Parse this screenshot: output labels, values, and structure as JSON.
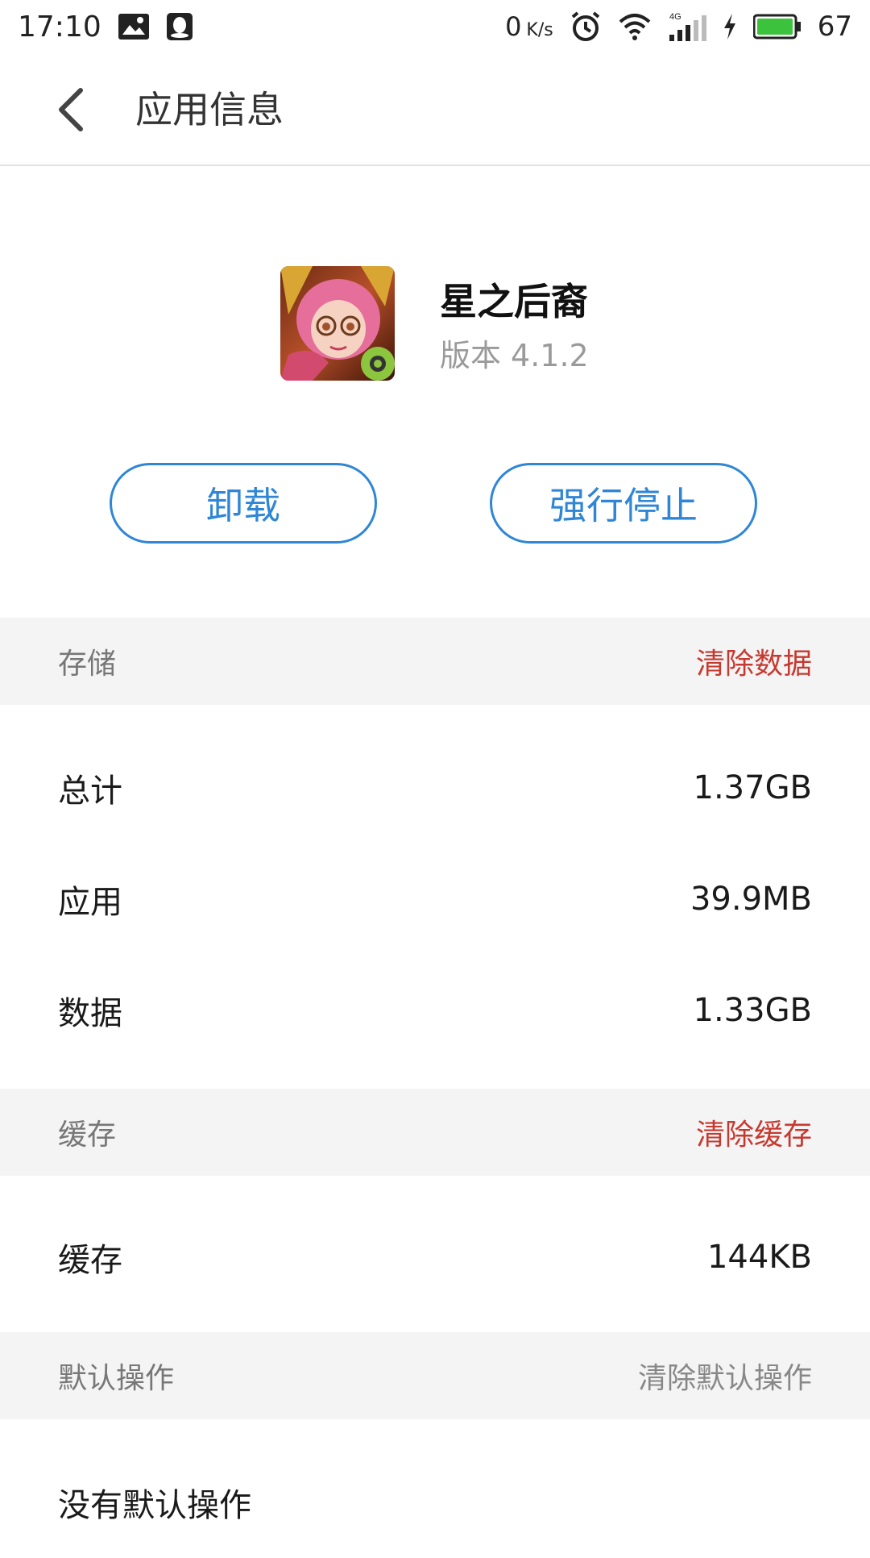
{
  "status_bar": {
    "time": "17:10",
    "net_speed_value": "0",
    "net_speed_unit": "K/s",
    "network_type": "4G",
    "battery_level": "67",
    "battery_color": "#3cc23c"
  },
  "title_bar": {
    "title": "应用信息"
  },
  "app": {
    "name": "星之后裔",
    "version_prefix": "版本",
    "version": "4.1.2"
  },
  "actions": {
    "uninstall_label": "卸载",
    "force_stop_label": "强行停止",
    "accent_color": "#2f86d6"
  },
  "storage": {
    "title": "存储",
    "action_label": "清除数据",
    "action_color": "#c7392f",
    "rows": [
      {
        "label": "总计",
        "value": "1.37GB"
      },
      {
        "label": "应用",
        "value": "39.9MB"
      },
      {
        "label": "数据",
        "value": "1.33GB"
      }
    ]
  },
  "cache": {
    "title": "缓存",
    "action_label": "清除缓存",
    "action_color": "#c7392f",
    "rows": [
      {
        "label": "缓存",
        "value": "144KB"
      }
    ]
  },
  "defaults": {
    "title": "默认操作",
    "action_label": "清除默认操作",
    "action_color": "#888888",
    "rows": [
      {
        "label": "没有默认操作"
      }
    ]
  }
}
